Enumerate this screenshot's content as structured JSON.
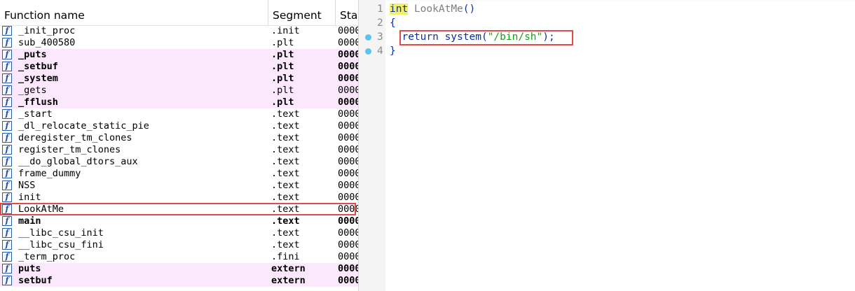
{
  "functions_window": {
    "columns": {
      "name": "Function name",
      "segment": "Segment",
      "start": "Start"
    },
    "icon": "function-icon",
    "icon_glyph": "f",
    "rows": [
      {
        "name": "_init_proc",
        "segment": ".init",
        "start": "0000",
        "highlight": false,
        "bold": false
      },
      {
        "name": "sub_400580",
        "segment": ".plt",
        "start": "0000",
        "highlight": false,
        "bold": false
      },
      {
        "name": "_puts",
        "segment": ".plt",
        "start": "0000",
        "highlight": true,
        "bold": true
      },
      {
        "name": "_setbuf",
        "segment": ".plt",
        "start": "0000",
        "highlight": true,
        "bold": true
      },
      {
        "name": "_system",
        "segment": ".plt",
        "start": "0000",
        "highlight": true,
        "bold": true
      },
      {
        "name": "_gets",
        "segment": ".plt",
        "start": "0000",
        "highlight": true,
        "bold": false
      },
      {
        "name": "_fflush",
        "segment": ".plt",
        "start": "0000",
        "highlight": true,
        "bold": true
      },
      {
        "name": "_start",
        "segment": ".text",
        "start": "0000",
        "highlight": false,
        "bold": false
      },
      {
        "name": "_dl_relocate_static_pie",
        "segment": ".text",
        "start": "0000",
        "highlight": false,
        "bold": false
      },
      {
        "name": "deregister_tm_clones",
        "segment": ".text",
        "start": "0000",
        "highlight": false,
        "bold": false
      },
      {
        "name": "register_tm_clones",
        "segment": ".text",
        "start": "0000",
        "highlight": false,
        "bold": false
      },
      {
        "name": "__do_global_dtors_aux",
        "segment": ".text",
        "start": "0000",
        "highlight": false,
        "bold": false
      },
      {
        "name": "frame_dummy",
        "segment": ".text",
        "start": "0000",
        "highlight": false,
        "bold": false
      },
      {
        "name": "NSS",
        "segment": ".text",
        "start": "0000",
        "highlight": false,
        "bold": false
      },
      {
        "name": "init",
        "segment": ".text",
        "start": "0000",
        "highlight": false,
        "bold": false
      },
      {
        "name": "LookAtMe",
        "segment": ".text",
        "start": "0000",
        "highlight": false,
        "bold": false,
        "selected": true
      },
      {
        "name": "main",
        "segment": ".text",
        "start": "0000",
        "highlight": false,
        "bold": true
      },
      {
        "name": "__libc_csu_init",
        "segment": ".text",
        "start": "0000",
        "highlight": false,
        "bold": false
      },
      {
        "name": "__libc_csu_fini",
        "segment": ".text",
        "start": "0000",
        "highlight": false,
        "bold": false
      },
      {
        "name": "_term_proc",
        "segment": ".fini",
        "start": "0000",
        "highlight": false,
        "bold": false
      },
      {
        "name": "puts",
        "segment": "extern",
        "start": "0000",
        "highlight": true,
        "bold": true
      },
      {
        "name": "setbuf",
        "segment": "extern",
        "start": "0000",
        "highlight": true,
        "bold": true
      }
    ],
    "colors": {
      "highlight_bg": "#fce8fc",
      "selection_border": "#e34a4a",
      "icon": "#1c4f9c"
    }
  },
  "pseudocode": {
    "lines": [
      {
        "num": "1",
        "dot": false,
        "parts": [
          {
            "t": "int",
            "c": "kw"
          },
          {
            "t": " ",
            "c": ""
          },
          {
            "t": "LookAtMe",
            "c": "fn"
          },
          {
            "t": "()",
            "c": ""
          }
        ]
      },
      {
        "num": "2",
        "dot": false,
        "parts": [
          {
            "t": "{",
            "c": ""
          }
        ]
      },
      {
        "num": "3",
        "dot": true,
        "parts": [
          {
            "t": "  return system(",
            "c": ""
          },
          {
            "t": "\"/bin/sh\"",
            "c": "str"
          },
          {
            "t": ");",
            "c": ""
          }
        ]
      },
      {
        "num": "4",
        "dot": true,
        "parts": [
          {
            "t": "}",
            "c": ""
          }
        ]
      }
    ],
    "colors": {
      "code": "#0b2f9e",
      "string": "#18a018",
      "keyword_bg": "#f2f06a",
      "breakpoint_dot": "#5bc3f0",
      "highlight_border": "#e34a4a"
    }
  }
}
